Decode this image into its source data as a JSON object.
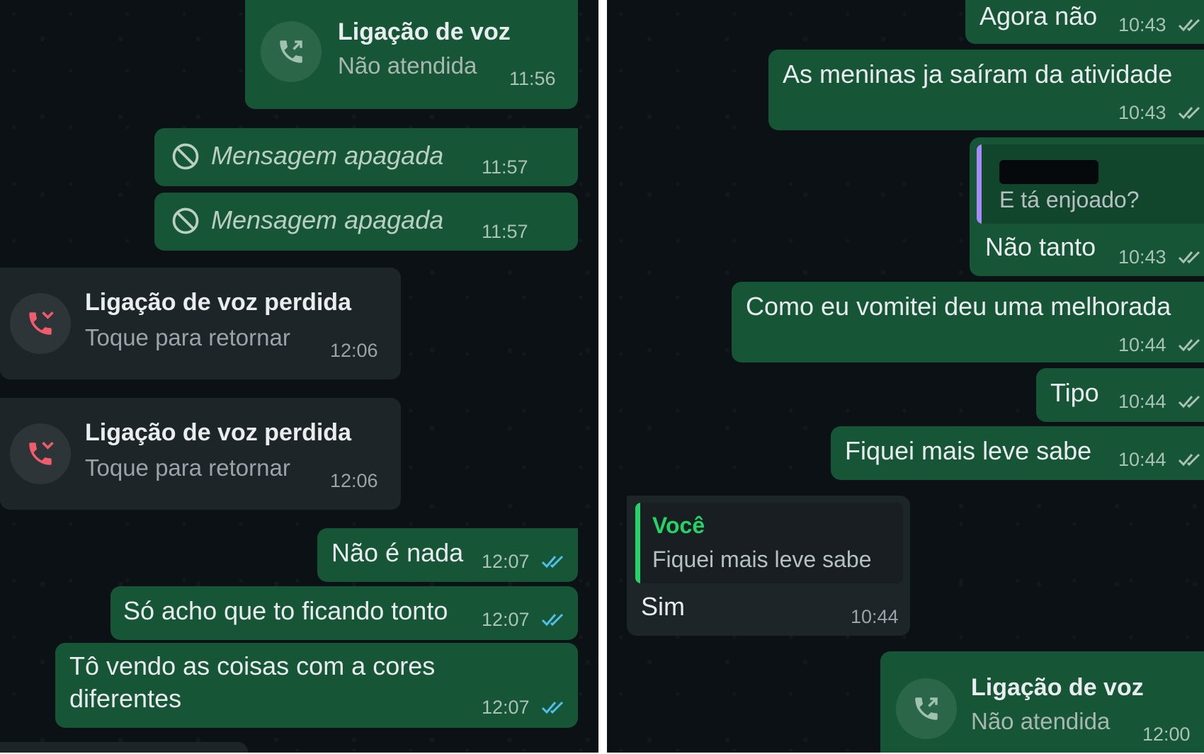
{
  "left_panel": {
    "voice_call": {
      "title": "Ligação de voz",
      "status": "Não atendida",
      "time": "11:56"
    },
    "deleted_1": {
      "text": "Mensagem apagada",
      "time": "11:57"
    },
    "deleted_2": {
      "text": "Mensagem apagada",
      "time": "11:57"
    },
    "missed_1": {
      "title": "Ligação de voz perdida",
      "sub": "Toque para retornar",
      "time": "12:06"
    },
    "missed_2": {
      "title": "Ligação de voz perdida",
      "sub": "Toque para retornar",
      "time": "12:06"
    },
    "msg_1": {
      "text": "Não é nada",
      "time": "12:07"
    },
    "msg_2": {
      "text": "Só acho que to ficando tonto",
      "time": "12:07"
    },
    "msg_3": {
      "line1": "Tô vendo as coisas com a cores",
      "line2": "diferentes",
      "time": "12:07"
    }
  },
  "right_panel": {
    "msg_1": {
      "text": "Agora não",
      "time": "10:43"
    },
    "msg_2": {
      "text": "As meninas ja saíram da atividade",
      "time": "10:43"
    },
    "reply_1": {
      "quote_text": "E tá enjoado?",
      "text": "Não tanto",
      "time": "10:43"
    },
    "msg_3": {
      "text": "Como eu vomitei deu uma melhorada",
      "time": "10:44"
    },
    "msg_4": {
      "text": "Tipo",
      "time": "10:44"
    },
    "msg_5": {
      "text": "Fiquei mais leve sabe",
      "time": "10:44"
    },
    "reply_in": {
      "quote_author": "Você",
      "quote_text": "Fiquei mais leve sabe",
      "text": "Sim",
      "time": "10:44"
    },
    "voice_call": {
      "title": "Ligação de voz",
      "status": "Não atendida",
      "time": "12:00"
    }
  },
  "colors": {
    "background": "#0b1115",
    "outgoing_bubble": "#165636",
    "incoming_bubble": "#1e2529",
    "read_ticks": "#53bdeb",
    "missed_call_icon": "#f15c6d",
    "quote_bar_self": "#25d366",
    "quote_bar_other": "#a78bfa"
  },
  "icons": [
    "phone-outgoing-icon",
    "phone-missed-icon",
    "ban-icon",
    "double-check-icon"
  ]
}
